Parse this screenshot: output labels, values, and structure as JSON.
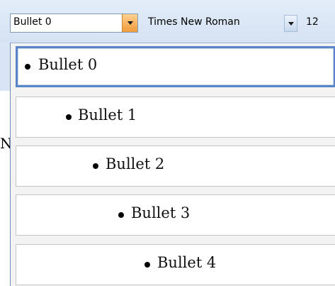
{
  "toolbar": {
    "style_value": "Bullet 0",
    "font_value": "Times New Roman",
    "size_value": "12"
  },
  "document": {
    "visible_letter": "N"
  },
  "styles_dropdown": {
    "items": [
      {
        "label": "Bullet 0",
        "selected": true
      },
      {
        "label": "Bullet 1",
        "selected": false
      },
      {
        "label": "Bullet 2",
        "selected": false
      },
      {
        "label": "Bullet 3",
        "selected": false
      },
      {
        "label": "Bullet 4",
        "selected": false
      }
    ]
  },
  "colors": {
    "accent": "#5b84c6",
    "dropdown_button": "#f09a3a"
  }
}
